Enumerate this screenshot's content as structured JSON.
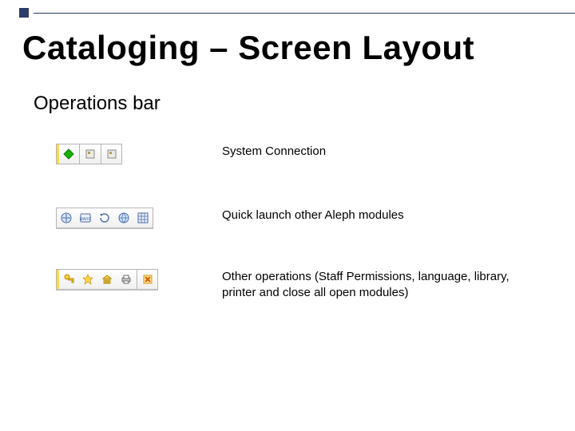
{
  "title": "Cataloging – Screen Layout",
  "subtitle": "Operations bar",
  "rows": {
    "sysconn": {
      "desc": "System Connection"
    },
    "quicklaunch": {
      "desc": "Quick launch other Aleph modules"
    },
    "otherops": {
      "desc": "Other operations (Staff Permissions, language, library, printer and close all open modules)"
    }
  }
}
